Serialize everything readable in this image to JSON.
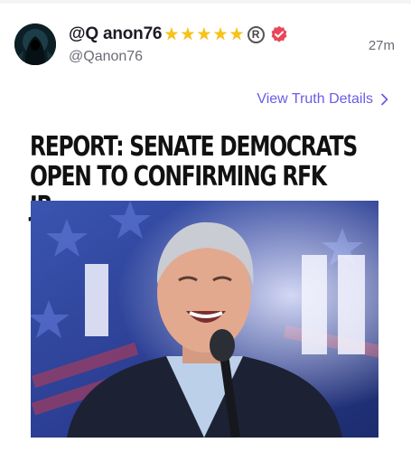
{
  "post": {
    "display_name": "@Q anon76",
    "stars": [
      "★",
      "★",
      "★",
      "★",
      "★"
    ],
    "registered_mark": "R",
    "handle": "@Qanon76",
    "timestamp": "27m",
    "details_link": "View Truth Details",
    "headline_line1": "REPORT: SENATE DEMOCRATS",
    "headline_line2": "OPEN TO CONFIRMING RFK JR."
  },
  "icons": {
    "avatar": "hooded-figure-avatar",
    "verified": "verified-badge-icon",
    "chevron": "chevron-right-icon"
  },
  "colors": {
    "accent": "#6c5ce7",
    "star": "#f7c21a",
    "verified": "#e8475a",
    "text_primary": "#1c1c24",
    "text_secondary": "#6b6b75"
  }
}
